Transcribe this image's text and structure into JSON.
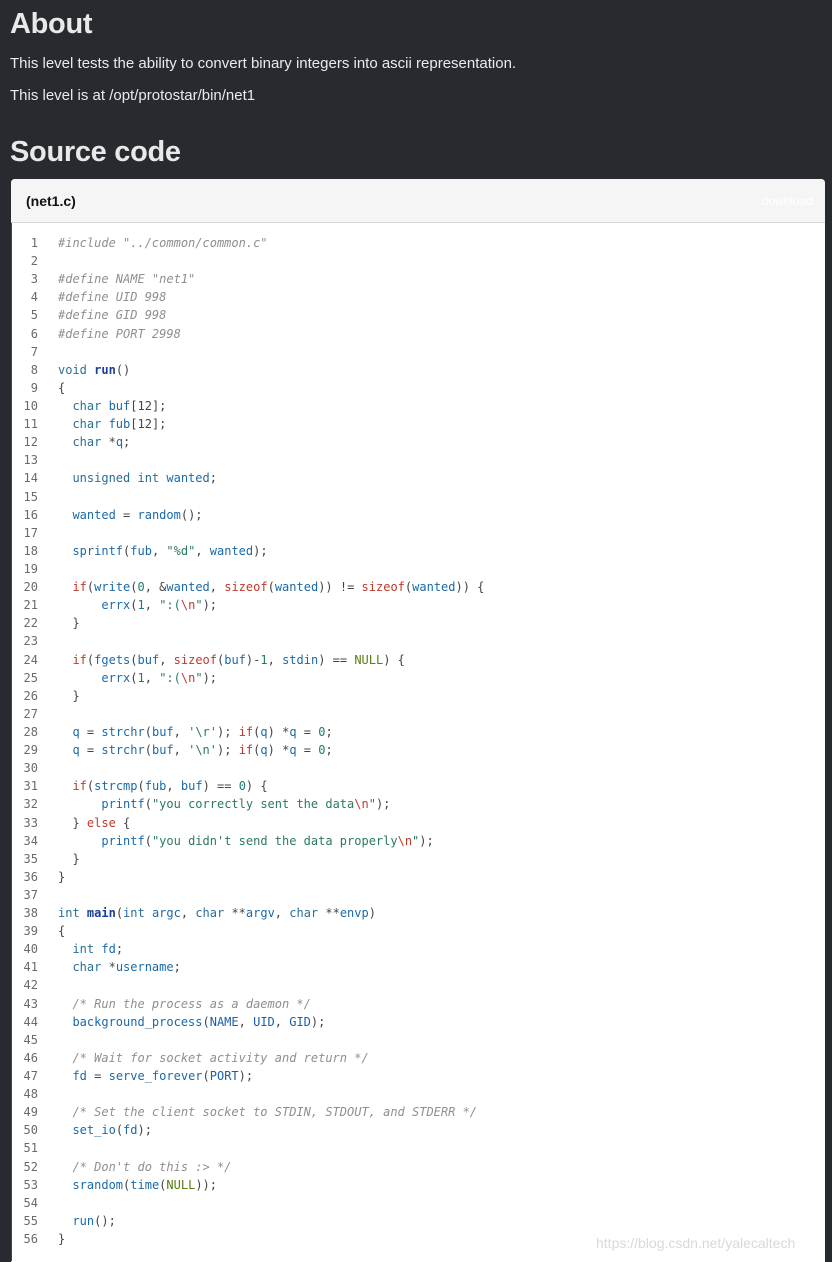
{
  "about": {
    "heading": "About",
    "description": "This level tests the ability to convert binary integers into ascii representation.",
    "path_text": "This level is at /opt/protostar/bin/net1"
  },
  "source": {
    "heading": "Source code",
    "filename": "(net1.c)",
    "download_label": "download",
    "lines": [
      {
        "n": "1",
        "t": [
          [
            "cm",
            "#include \"../common/common.c\""
          ]
        ]
      },
      {
        "n": "2",
        "t": []
      },
      {
        "n": "3",
        "t": [
          [
            "cm",
            "#define NAME \"net1\""
          ]
        ]
      },
      {
        "n": "4",
        "t": [
          [
            "cm",
            "#define UID 998"
          ]
        ]
      },
      {
        "n": "5",
        "t": [
          [
            "cm",
            "#define GID 998"
          ]
        ]
      },
      {
        "n": "6",
        "t": [
          [
            "cm",
            "#define PORT 2998"
          ]
        ]
      },
      {
        "n": "7",
        "t": []
      },
      {
        "n": "8",
        "t": [
          [
            "kw",
            "void "
          ],
          [
            "fn",
            "run"
          ],
          [
            "pu",
            "()"
          ]
        ]
      },
      {
        "n": "9",
        "t": [
          [
            "pu",
            "{"
          ]
        ]
      },
      {
        "n": "10",
        "t": [
          [
            "pu",
            "  "
          ],
          [
            "kw",
            "char "
          ],
          [
            "fc",
            "buf"
          ],
          [
            "pu",
            "[12];"
          ]
        ]
      },
      {
        "n": "11",
        "t": [
          [
            "pu",
            "  "
          ],
          [
            "kw",
            "char "
          ],
          [
            "fc",
            "fub"
          ],
          [
            "pu",
            "[12];"
          ]
        ]
      },
      {
        "n": "12",
        "t": [
          [
            "pu",
            "  "
          ],
          [
            "kw",
            "char "
          ],
          [
            "pu",
            "*"
          ],
          [
            "fc",
            "q"
          ],
          [
            "pu",
            ";"
          ]
        ]
      },
      {
        "n": "13",
        "t": []
      },
      {
        "n": "14",
        "t": [
          [
            "pu",
            "  "
          ],
          [
            "kw",
            "unsigned int "
          ],
          [
            "fc",
            "wanted"
          ],
          [
            "pu",
            ";"
          ]
        ]
      },
      {
        "n": "15",
        "t": []
      },
      {
        "n": "16",
        "t": [
          [
            "pu",
            "  "
          ],
          [
            "fc",
            "wanted"
          ],
          [
            "pu",
            " = "
          ],
          [
            "fc",
            "random"
          ],
          [
            "pu",
            "();"
          ]
        ]
      },
      {
        "n": "17",
        "t": []
      },
      {
        "n": "18",
        "t": [
          [
            "pu",
            "  "
          ],
          [
            "fc",
            "sprintf"
          ],
          [
            "pu",
            "("
          ],
          [
            "fc",
            "fub"
          ],
          [
            "pu",
            ", "
          ],
          [
            "str",
            "\"%d\""
          ],
          [
            "pu",
            ", "
          ],
          [
            "fc",
            "wanted"
          ],
          [
            "pu",
            ");"
          ]
        ]
      },
      {
        "n": "19",
        "t": []
      },
      {
        "n": "20",
        "t": [
          [
            "pu",
            "  "
          ],
          [
            "ck",
            "if"
          ],
          [
            "pu",
            "("
          ],
          [
            "fc",
            "write"
          ],
          [
            "pu",
            "("
          ],
          [
            "nm",
            "0"
          ],
          [
            "pu",
            ", &"
          ],
          [
            "fc",
            "wanted"
          ],
          [
            "pu",
            ", "
          ],
          [
            "ck",
            "sizeof"
          ],
          [
            "pu",
            "("
          ],
          [
            "fc",
            "wanted"
          ],
          [
            "pu",
            ")) != "
          ],
          [
            "ck",
            "sizeof"
          ],
          [
            "pu",
            "("
          ],
          [
            "fc",
            "wanted"
          ],
          [
            "pu",
            ")) {"
          ]
        ]
      },
      {
        "n": "21",
        "t": [
          [
            "pu",
            "      "
          ],
          [
            "fc",
            "errx"
          ],
          [
            "pu",
            "("
          ],
          [
            "nm",
            "1"
          ],
          [
            "pu",
            ", "
          ],
          [
            "str",
            "\":("
          ],
          [
            "esc",
            "\\n"
          ],
          [
            "str",
            "\""
          ],
          [
            "pu",
            ");"
          ]
        ]
      },
      {
        "n": "22",
        "t": [
          [
            "pu",
            "  }"
          ]
        ]
      },
      {
        "n": "23",
        "t": []
      },
      {
        "n": "24",
        "t": [
          [
            "pu",
            "  "
          ],
          [
            "ck",
            "if"
          ],
          [
            "pu",
            "("
          ],
          [
            "fc",
            "fgets"
          ],
          [
            "pu",
            "("
          ],
          [
            "fc",
            "buf"
          ],
          [
            "pu",
            ", "
          ],
          [
            "ck",
            "sizeof"
          ],
          [
            "pu",
            "("
          ],
          [
            "fc",
            "buf"
          ],
          [
            "pu",
            ")-"
          ],
          [
            "nm",
            "1"
          ],
          [
            "pu",
            ", "
          ],
          [
            "fc",
            "stdin"
          ],
          [
            "pu",
            ") == "
          ],
          [
            "nl",
            "NULL"
          ],
          [
            "pu",
            ") {"
          ]
        ]
      },
      {
        "n": "25",
        "t": [
          [
            "pu",
            "      "
          ],
          [
            "fc",
            "errx"
          ],
          [
            "pu",
            "("
          ],
          [
            "nm",
            "1"
          ],
          [
            "pu",
            ", "
          ],
          [
            "str",
            "\":("
          ],
          [
            "esc",
            "\\n"
          ],
          [
            "str",
            "\""
          ],
          [
            "pu",
            ");"
          ]
        ]
      },
      {
        "n": "26",
        "t": [
          [
            "pu",
            "  }"
          ]
        ]
      },
      {
        "n": "27",
        "t": []
      },
      {
        "n": "28",
        "t": [
          [
            "pu",
            "  "
          ],
          [
            "fc",
            "q"
          ],
          [
            "pu",
            " = "
          ],
          [
            "fc",
            "strchr"
          ],
          [
            "pu",
            "("
          ],
          [
            "fc",
            "buf"
          ],
          [
            "pu",
            ", "
          ],
          [
            "str",
            "'\\r'"
          ],
          [
            "pu",
            "); "
          ],
          [
            "ck",
            "if"
          ],
          [
            "pu",
            "("
          ],
          [
            "fc",
            "q"
          ],
          [
            "pu",
            ") *"
          ],
          [
            "fc",
            "q"
          ],
          [
            "pu",
            " = "
          ],
          [
            "nm",
            "0"
          ],
          [
            "pu",
            ";"
          ]
        ]
      },
      {
        "n": "29",
        "t": [
          [
            "pu",
            "  "
          ],
          [
            "fc",
            "q"
          ],
          [
            "pu",
            " = "
          ],
          [
            "fc",
            "strchr"
          ],
          [
            "pu",
            "("
          ],
          [
            "fc",
            "buf"
          ],
          [
            "pu",
            ", "
          ],
          [
            "str",
            "'\\n'"
          ],
          [
            "pu",
            "); "
          ],
          [
            "ck",
            "if"
          ],
          [
            "pu",
            "("
          ],
          [
            "fc",
            "q"
          ],
          [
            "pu",
            ") *"
          ],
          [
            "fc",
            "q"
          ],
          [
            "pu",
            " = "
          ],
          [
            "nm",
            "0"
          ],
          [
            "pu",
            ";"
          ]
        ]
      },
      {
        "n": "30",
        "t": []
      },
      {
        "n": "31",
        "t": [
          [
            "pu",
            "  "
          ],
          [
            "ck",
            "if"
          ],
          [
            "pu",
            "("
          ],
          [
            "fc",
            "strcmp"
          ],
          [
            "pu",
            "("
          ],
          [
            "fc",
            "fub"
          ],
          [
            "pu",
            ", "
          ],
          [
            "fc",
            "buf"
          ],
          [
            "pu",
            ") == "
          ],
          [
            "nm",
            "0"
          ],
          [
            "pu",
            ") {"
          ]
        ]
      },
      {
        "n": "32",
        "t": [
          [
            "pu",
            "      "
          ],
          [
            "fc",
            "printf"
          ],
          [
            "pu",
            "("
          ],
          [
            "str",
            "\"you correctly sent the data"
          ],
          [
            "esc",
            "\\n"
          ],
          [
            "str",
            "\""
          ],
          [
            "pu",
            ");"
          ]
        ]
      },
      {
        "n": "33",
        "t": [
          [
            "pu",
            "  } "
          ],
          [
            "ck",
            "else"
          ],
          [
            "pu",
            " {"
          ]
        ]
      },
      {
        "n": "34",
        "t": [
          [
            "pu",
            "      "
          ],
          [
            "fc",
            "printf"
          ],
          [
            "pu",
            "("
          ],
          [
            "str",
            "\"you didn't send the data properly"
          ],
          [
            "esc",
            "\\n"
          ],
          [
            "str",
            "\""
          ],
          [
            "pu",
            ");"
          ]
        ]
      },
      {
        "n": "35",
        "t": [
          [
            "pu",
            "  }"
          ]
        ]
      },
      {
        "n": "36",
        "t": [
          [
            "pu",
            "}"
          ]
        ]
      },
      {
        "n": "37",
        "t": []
      },
      {
        "n": "38",
        "t": [
          [
            "kw",
            "int "
          ],
          [
            "fn",
            "main"
          ],
          [
            "pu",
            "("
          ],
          [
            "kw",
            "int "
          ],
          [
            "fc",
            "argc"
          ],
          [
            "pu",
            ", "
          ],
          [
            "kw",
            "char "
          ],
          [
            "pu",
            "**"
          ],
          [
            "fc",
            "argv"
          ],
          [
            "pu",
            ", "
          ],
          [
            "kw",
            "char "
          ],
          [
            "pu",
            "**"
          ],
          [
            "fc",
            "envp"
          ],
          [
            "pu",
            ")"
          ]
        ]
      },
      {
        "n": "39",
        "t": [
          [
            "pu",
            "{"
          ]
        ]
      },
      {
        "n": "40",
        "t": [
          [
            "pu",
            "  "
          ],
          [
            "kw",
            "int "
          ],
          [
            "fc",
            "fd"
          ],
          [
            "pu",
            ";"
          ]
        ]
      },
      {
        "n": "41",
        "t": [
          [
            "pu",
            "  "
          ],
          [
            "kw",
            "char "
          ],
          [
            "pu",
            "*"
          ],
          [
            "fc",
            "username"
          ],
          [
            "pu",
            ";"
          ]
        ]
      },
      {
        "n": "42",
        "t": []
      },
      {
        "n": "43",
        "t": [
          [
            "pu",
            "  "
          ],
          [
            "cm",
            "/* Run the process as a daemon */"
          ]
        ]
      },
      {
        "n": "44",
        "t": [
          [
            "pu",
            "  "
          ],
          [
            "fc",
            "background_process"
          ],
          [
            "pu",
            "("
          ],
          [
            "cn",
            "NAME"
          ],
          [
            "pu",
            ", "
          ],
          [
            "cn",
            "UID"
          ],
          [
            "pu",
            ", "
          ],
          [
            "cn",
            "GID"
          ],
          [
            "pu",
            ");"
          ]
        ]
      },
      {
        "n": "45",
        "t": []
      },
      {
        "n": "46",
        "t": [
          [
            "pu",
            "  "
          ],
          [
            "cm",
            "/* Wait for socket activity and return */"
          ]
        ]
      },
      {
        "n": "47",
        "t": [
          [
            "pu",
            "  "
          ],
          [
            "fc",
            "fd"
          ],
          [
            "pu",
            " = "
          ],
          [
            "fc",
            "serve_forever"
          ],
          [
            "pu",
            "("
          ],
          [
            "cn",
            "PORT"
          ],
          [
            "pu",
            ");"
          ]
        ]
      },
      {
        "n": "48",
        "t": []
      },
      {
        "n": "49",
        "t": [
          [
            "pu",
            "  "
          ],
          [
            "cm",
            "/* Set the client socket to STDIN, STDOUT, and STDERR */"
          ]
        ]
      },
      {
        "n": "50",
        "t": [
          [
            "pu",
            "  "
          ],
          [
            "fc",
            "set_io"
          ],
          [
            "pu",
            "("
          ],
          [
            "fc",
            "fd"
          ],
          [
            "pu",
            ");"
          ]
        ]
      },
      {
        "n": "51",
        "t": []
      },
      {
        "n": "52",
        "t": [
          [
            "pu",
            "  "
          ],
          [
            "cm",
            "/* Don't do this :> */"
          ]
        ]
      },
      {
        "n": "53",
        "t": [
          [
            "pu",
            "  "
          ],
          [
            "fc",
            "srandom"
          ],
          [
            "pu",
            "("
          ],
          [
            "fc",
            "time"
          ],
          [
            "pu",
            "("
          ],
          [
            "nl",
            "NULL"
          ],
          [
            "pu",
            "));"
          ]
        ]
      },
      {
        "n": "54",
        "t": []
      },
      {
        "n": "55",
        "t": [
          [
            "pu",
            "  "
          ],
          [
            "fc",
            "run"
          ],
          [
            "pu",
            "();"
          ]
        ]
      },
      {
        "n": "56",
        "t": [
          [
            "pu",
            "}"
          ]
        ]
      }
    ]
  },
  "watermark": "https://blog.csdn.net/yalecaltech"
}
